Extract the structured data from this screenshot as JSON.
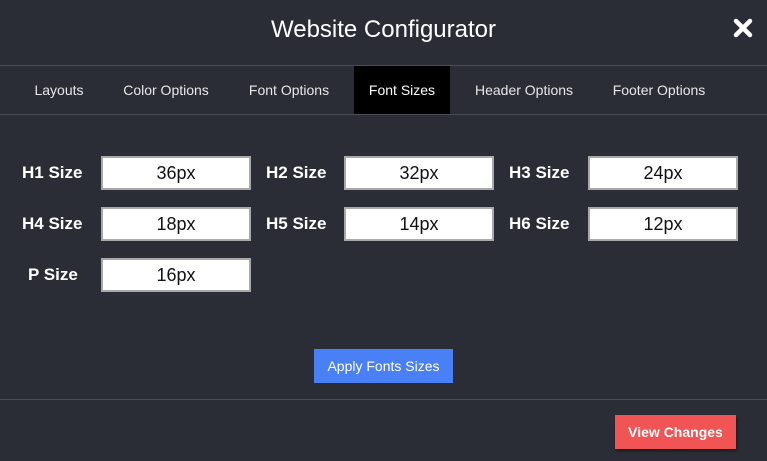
{
  "dialog": {
    "title": "Website Configurator",
    "close_icon": "close-icon"
  },
  "tabs": [
    {
      "label": "Layouts",
      "active": false
    },
    {
      "label": "Color Options",
      "active": false
    },
    {
      "label": "Font Options",
      "active": false
    },
    {
      "label": "Font Sizes",
      "active": true
    },
    {
      "label": "Header Options",
      "active": false
    },
    {
      "label": "Footer Options",
      "active": false
    }
  ],
  "fields": {
    "h1": {
      "label": "H1 Size",
      "value": "36px"
    },
    "h2": {
      "label": "H2 Size",
      "value": "32px"
    },
    "h3": {
      "label": "H3 Size",
      "value": "24px"
    },
    "h4": {
      "label": "H4 Size",
      "value": "18px"
    },
    "h5": {
      "label": "H5 Size",
      "value": "14px"
    },
    "h6": {
      "label": "H6 Size",
      "value": "12px"
    },
    "p": {
      "label": "P Size",
      "value": "16px"
    }
  },
  "apply_button": {
    "label": "Apply Fonts Sizes"
  },
  "view_button": {
    "label": "View Changes"
  },
  "colors": {
    "background": "#2a2d36",
    "active_tab": "#000000",
    "apply_button": "#4a80f5",
    "view_button": "#f05454"
  }
}
